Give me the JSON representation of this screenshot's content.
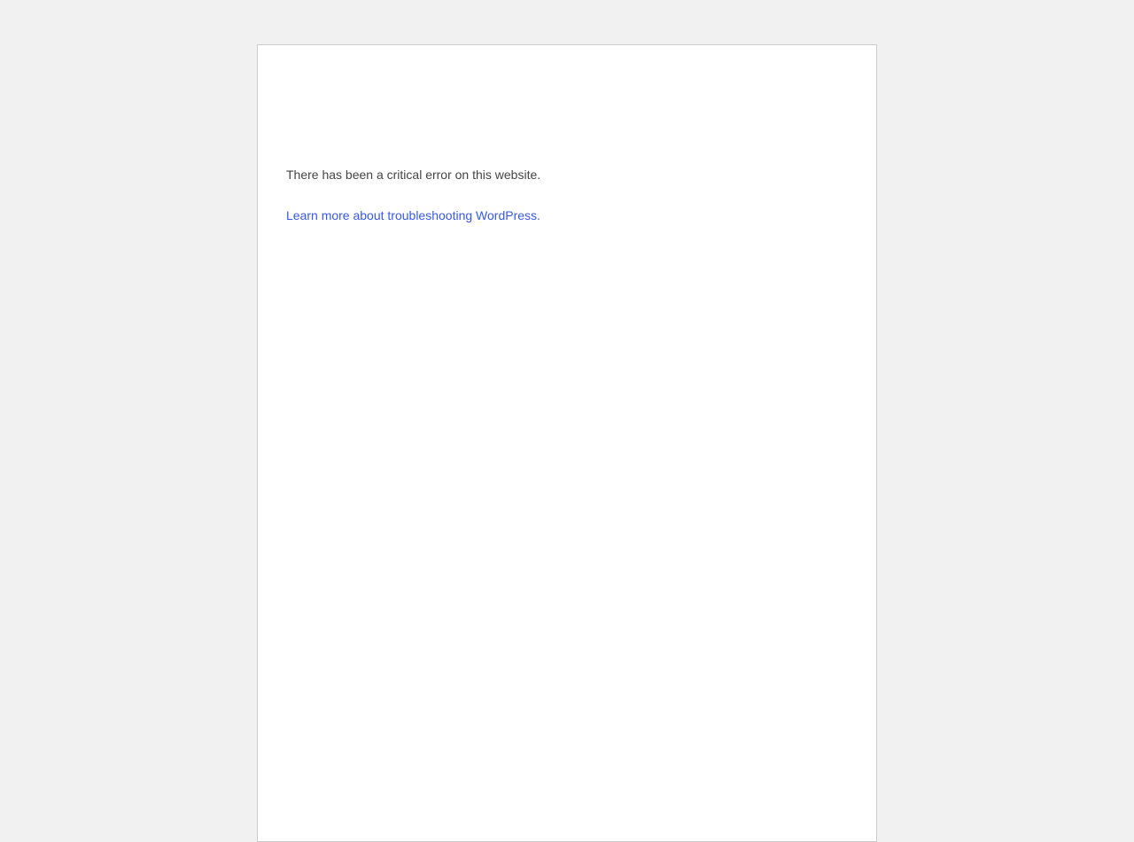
{
  "error_page": {
    "message": "There has been a critical error on this website.",
    "help_link_text": "Learn more about troubleshooting WordPress."
  },
  "colors": {
    "background": "#f1f1f1",
    "panel": "#ffffff",
    "text": "#444444",
    "link": "#3858e9"
  }
}
